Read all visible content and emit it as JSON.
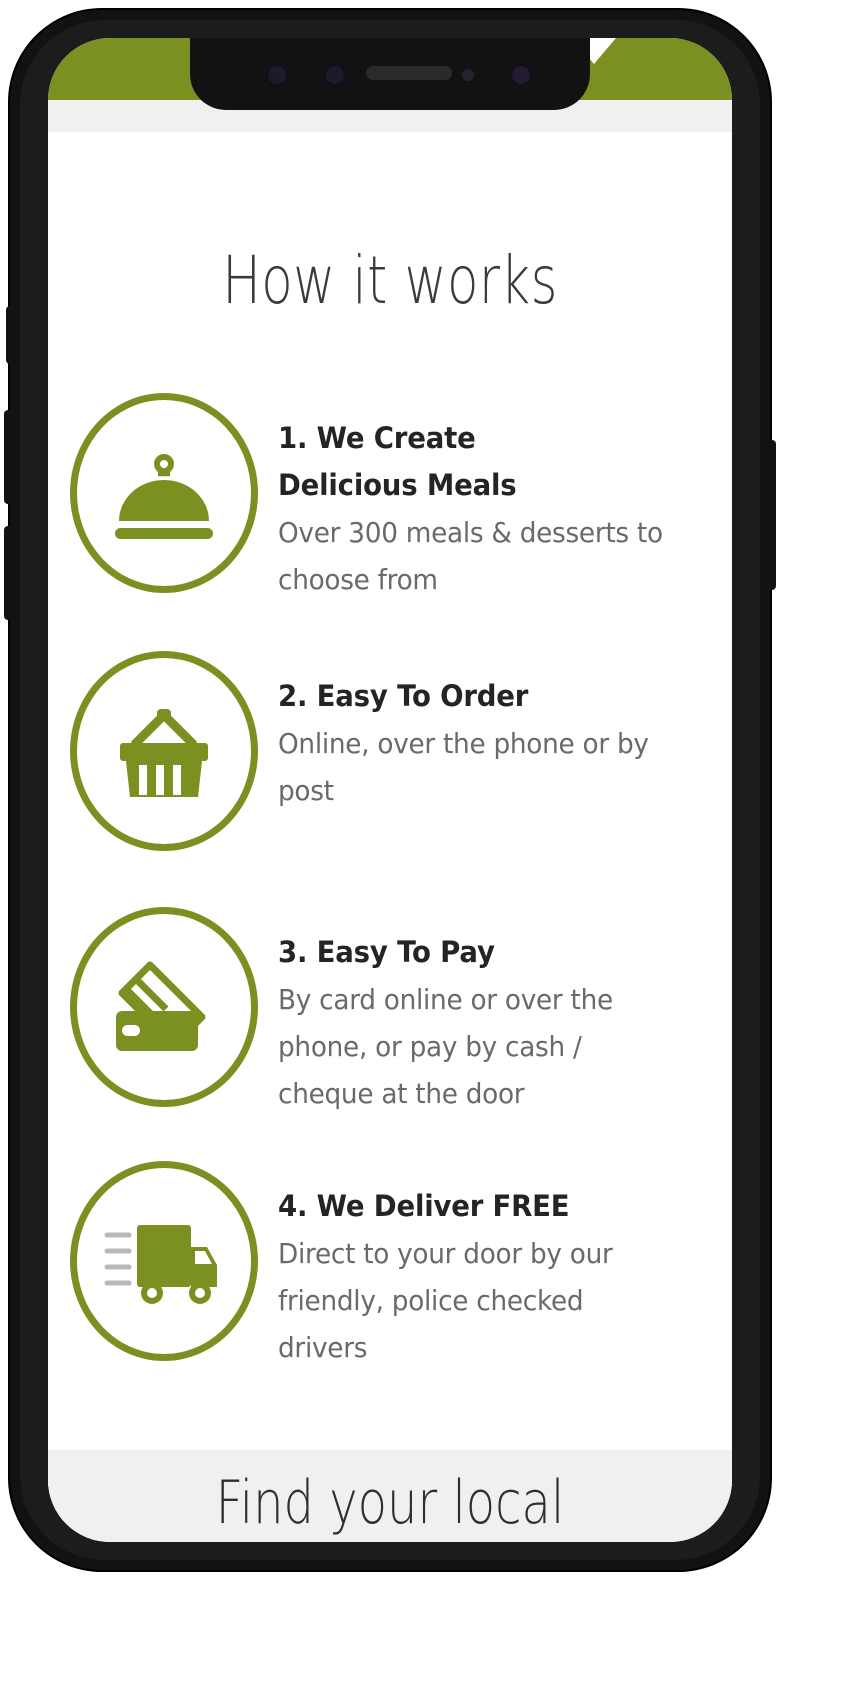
{
  "device": {
    "frame": "smartphone-mockup",
    "notch_icons": [
      "camera",
      "camera",
      "earpiece-speaker",
      "sensor",
      "camera"
    ]
  },
  "theme": {
    "brand_green": "#7a9122",
    "title_color": "#3b3b3b",
    "heading_color": "#242424",
    "body_color": "#6a6a6a",
    "page_background": "#ffffff",
    "footer_background": "#f0f0f0"
  },
  "page": {
    "title": "How it works"
  },
  "steps": [
    {
      "icon": "cloche-icon",
      "title_line_1": "1. We Create",
      "title_line_2": "Delicious Meals",
      "description": "Over 300 meals & desserts to choose from"
    },
    {
      "icon": "shopping-basket-icon",
      "title_line_1": "2. Easy To Order",
      "title_line_2": "",
      "description": "Online, over the phone or by post"
    },
    {
      "icon": "credit-card-icon",
      "title_line_1": "3. Easy To Pay",
      "title_line_2": "",
      "description": "By card online or over the phone, or pay by cash / cheque at the door"
    },
    {
      "icon": "delivery-truck-icon",
      "title_line_1": "4. We Deliver FREE",
      "title_line_2": "",
      "description": "Direct to your door by our friendly, police checked drivers"
    }
  ],
  "footer": {
    "text": "Find your local"
  }
}
